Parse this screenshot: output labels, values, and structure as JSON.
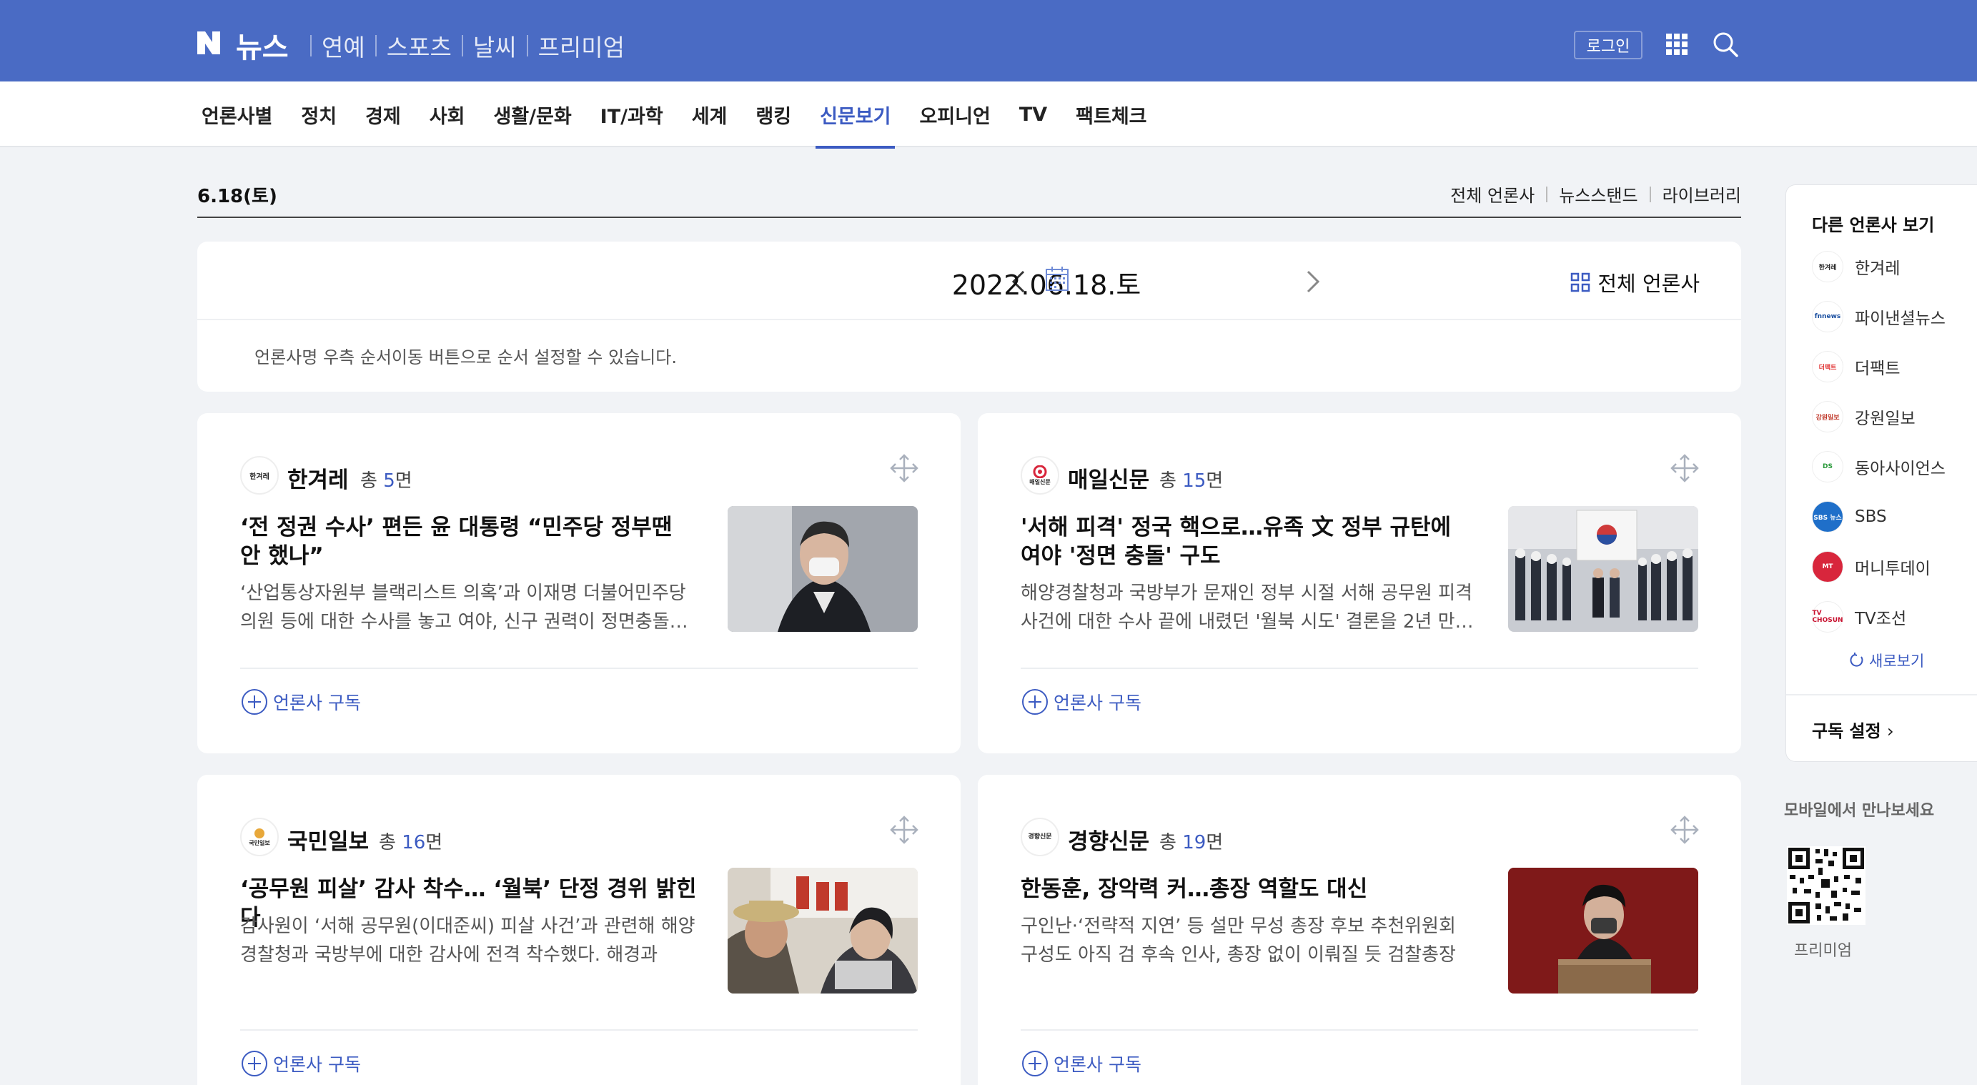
{
  "header": {
    "logo_letter": "N",
    "logo_text": "뉴스",
    "nav": [
      "연예",
      "스포츠",
      "날씨",
      "프리미엄"
    ],
    "login_label": "로그인"
  },
  "categories": [
    {
      "label": "언론사별",
      "active": false
    },
    {
      "label": "정치",
      "active": false
    },
    {
      "label": "경제",
      "active": false
    },
    {
      "label": "사회",
      "active": false
    },
    {
      "label": "생활/문화",
      "active": false
    },
    {
      "label": "IT/과학",
      "active": false
    },
    {
      "label": "세계",
      "active": false
    },
    {
      "label": "랭킹",
      "active": false
    },
    {
      "label": "신문보기",
      "active": true
    },
    {
      "label": "오피니언",
      "active": false
    },
    {
      "label": "TV",
      "active": false
    },
    {
      "label": "팩트체크",
      "active": false
    }
  ],
  "date_row": {
    "label": "6.18(토)",
    "links": [
      "전체 언론사",
      "뉴스스탠드",
      "라이브러리"
    ]
  },
  "date_panel": {
    "date": "2022.06.18.토",
    "all_press": "전체 언론사",
    "hint": "언론사명 우측 순서이동 버튼으로 순서 설정할 수 있습니다."
  },
  "cards": [
    {
      "press": "한겨레",
      "logo_text": "한겨레",
      "count_prefix": "총",
      "count": "5",
      "count_suffix": "면",
      "headline": "‘전 정권 수사’ 편든 윤 대통령 “민주당 정부땐 안 했나”",
      "summary": "‘산업통상자원부 블랙리스트 의혹’과 이재명 더불어민주당 의원 등에 대한 수사를 놓고 여야, 신구 권력이 정면충돌…",
      "subscribe": "언론사 구독"
    },
    {
      "press": "매일신문",
      "logo_text": "매일신문",
      "count_prefix": "총",
      "count": "15",
      "count_suffix": "면",
      "headline": "'서해 피격' 정국 핵으로…유족 文 정부 규탄에 여야 '정면 충돌' 구도",
      "summary": "해양경찰청과 국방부가 문재인 정부 시절 서해 공무원 피격 사건에 대한 수사 끝에 내렸던 '월북 시도' 결론을 2년 만…",
      "subscribe": "언론사 구독"
    },
    {
      "press": "국민일보",
      "logo_text": "국민일보",
      "count_prefix": "총",
      "count": "16",
      "count_suffix": "면",
      "headline": "‘공무원 피살’ 감사 착수… ‘월북’ 단정 경위 밝힌다",
      "summary": "감사원이 ‘서해 공무원(이대준씨) 피살 사건’과 관련해 해양경찰청과 국방부에 대한 감사에 전격 착수했다. 해경과 국…",
      "subscribe": "언론사 구독"
    },
    {
      "press": "경향신문",
      "logo_text": "경향신문",
      "count_prefix": "총",
      "count": "19",
      "count_suffix": "면",
      "headline": "한동훈, 장악력 커…총장 역할도 대신",
      "summary": "구인난·‘전략적 지연’ 등 설만 무성 총장 후보 추천위원회 구성도 아직 검 후속 인사, 총장 없이 이뤄질 듯 검찰총장 공…",
      "subscribe": "언론사 구독"
    }
  ],
  "sidebar": {
    "title": "다른 언론사 보기",
    "items": [
      {
        "name": "한겨레",
        "logo": "한겨레",
        "color": "#222222",
        "bg": "#ffffff"
      },
      {
        "name": "파이낸셜뉴스",
        "logo": "fnnews",
        "color": "#1a4fa0",
        "bg": "#ffffff"
      },
      {
        "name": "더팩트",
        "logo": "더팩트",
        "color": "#e23b3b",
        "bg": "#ffffff"
      },
      {
        "name": "강원일보",
        "logo": "강원일보",
        "color": "#c0392b",
        "bg": "#ffffff"
      },
      {
        "name": "동아사이언스",
        "logo": "DS",
        "color": "#2a9a3b",
        "bg": "#ffffff"
      },
      {
        "name": "SBS",
        "logo": "SBS 뉴스",
        "color": "#ffffff",
        "bg": "#1f6fc9"
      },
      {
        "name": "머니투데이",
        "logo": "MT",
        "color": "#ffffff",
        "bg": "#d8263c"
      },
      {
        "name": "TV조선",
        "logo": "TV CHOSUN",
        "color": "#c8102e",
        "bg": "#ffffff"
      }
    ],
    "refresh_label": "새로보기",
    "subscribe_setting": "구독 설정",
    "mobile_label": "모바일에서 만나보세요",
    "premium_label": "프리미엄"
  },
  "colors": {
    "brand": "#4a6bc4",
    "accent": "#3c5bc2"
  }
}
